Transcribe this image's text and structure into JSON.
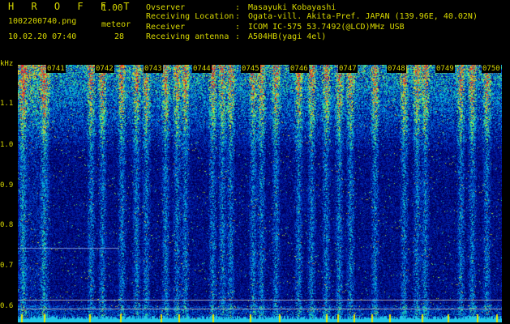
{
  "header": {
    "app_title": "H R O F F T",
    "app_version": "1.00",
    "file_name": "1002200740.png",
    "file_datetime": "10.02.20 07:40",
    "meteor_label": "meteor",
    "meteor_count": "28",
    "info": [
      {
        "key": "Ovserver",
        "value": "Masayuki Kobayashi"
      },
      {
        "key": "Receiving Location",
        "value": "Ogata-vill. Akita-Pref. JAPAN (139.96E, 40.02N)"
      },
      {
        "key": "Receiver",
        "value": "ICOM IC-575 53.7492(@LCD)MHz USB"
      },
      {
        "key": "Receiving antenna",
        "value": "A504HB(yagi 4el)"
      }
    ],
    "colon": ":"
  },
  "axis": {
    "y_unit": "kHz",
    "y_ticks": [
      "1.1",
      "1.0",
      "0.9",
      "0.8",
      "0.7",
      "0.6"
    ],
    "x_ticks": [
      "0741",
      "0742",
      "0743",
      "0744",
      "0745",
      "0746",
      "0747",
      "0748",
      "0749",
      "0750"
    ]
  },
  "colors": {
    "label": "#d8d800",
    "background": "#000000"
  }
}
